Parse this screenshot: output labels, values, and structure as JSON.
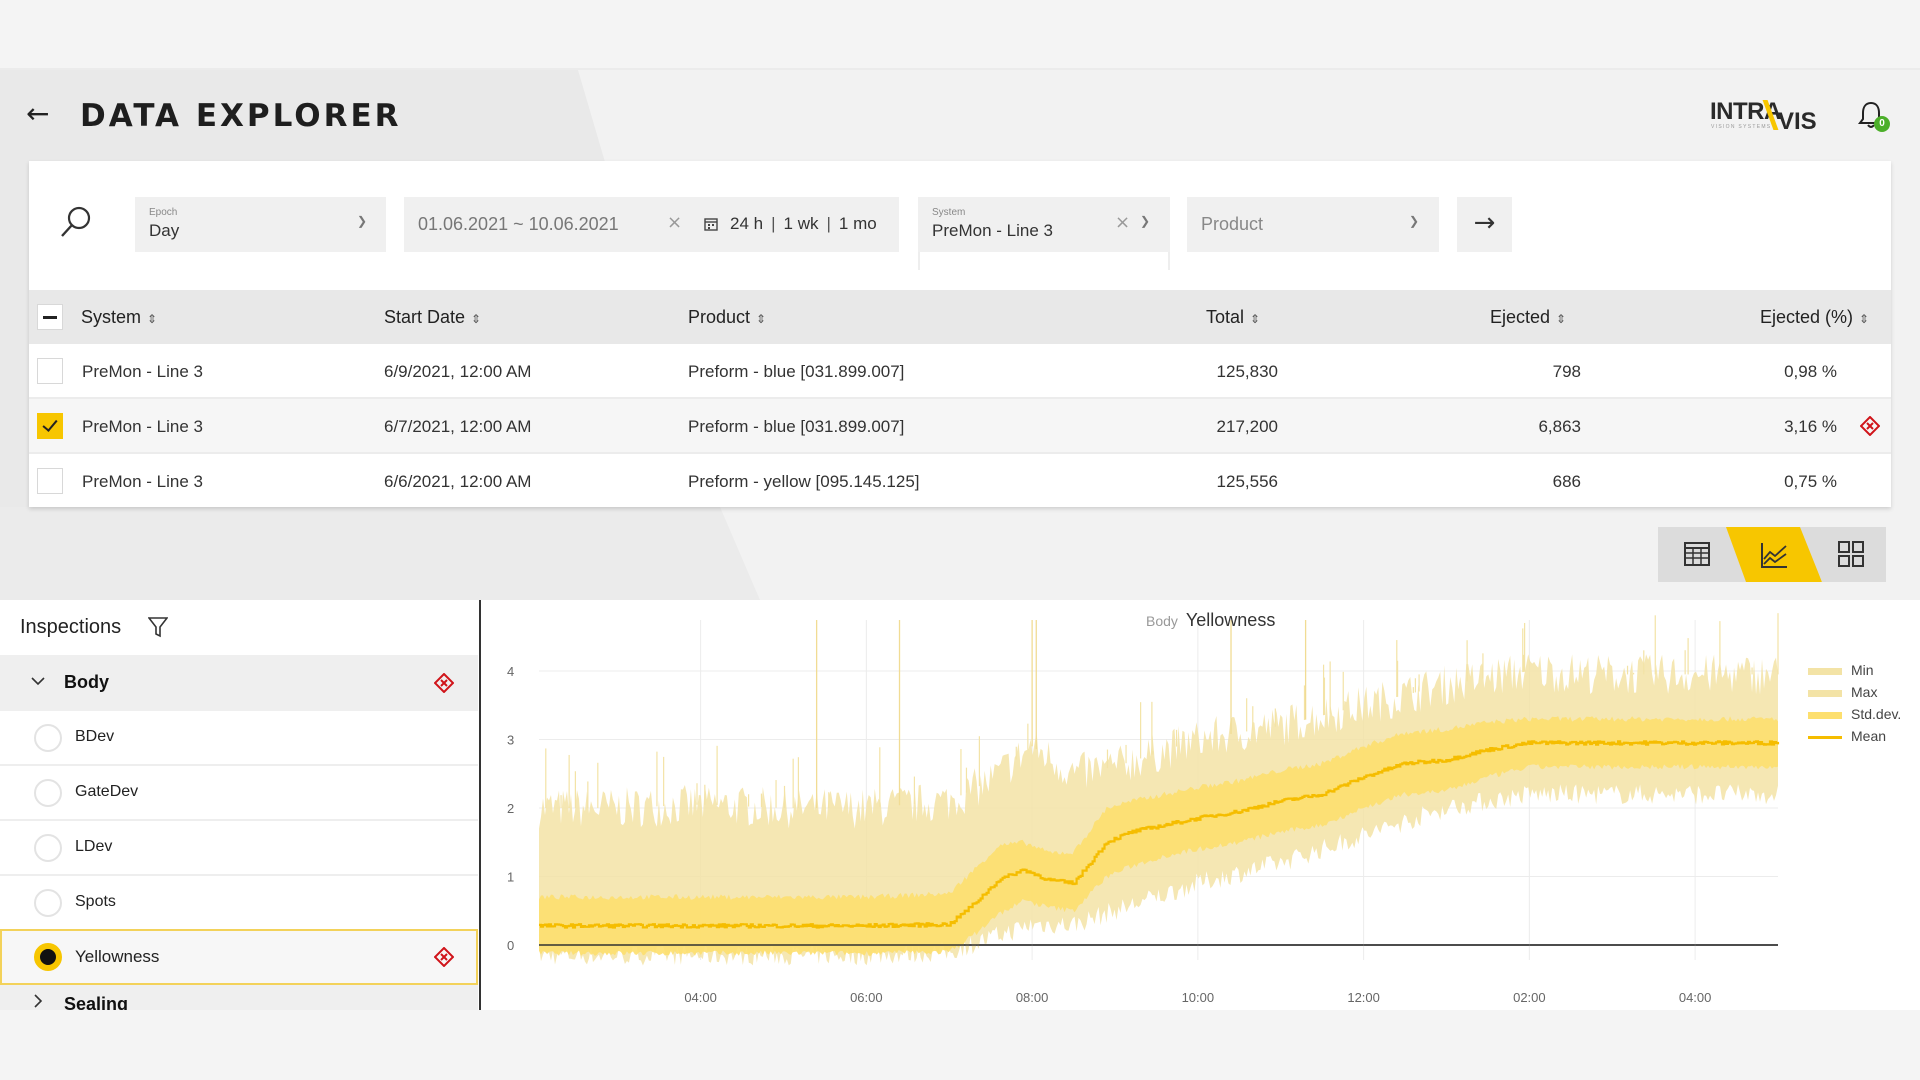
{
  "header": {
    "title": "DATA EXPLORER",
    "logo_main": "INTRA",
    "logo_vis": "VIS",
    "logo_sub": "VISION SYSTEMS",
    "notification_count": "0"
  },
  "filters": {
    "epoch": {
      "label": "Epoch",
      "value": "Day"
    },
    "date_range": {
      "value": "01.06.2021 ~ 10.06.2021",
      "quick": [
        "24 h",
        "1 wk",
        "1 mo"
      ]
    },
    "system": {
      "label": "System",
      "value": "PreMon - Line 3"
    },
    "product": {
      "placeholder": "Product"
    }
  },
  "table": {
    "columns": [
      "System",
      "Start Date",
      "Product",
      "Total",
      "Ejected",
      "Ejected (%)"
    ],
    "rows": [
      {
        "system": "PreMon - Line 3",
        "start": "6/9/2021, 12:00 AM",
        "product": "Preform - blue [031.899.007]",
        "total": "125,830",
        "ejected": "798",
        "pct": "0,98 %",
        "checked": false,
        "warning": false
      },
      {
        "system": "PreMon - Line 3",
        "start": "6/7/2021, 12:00 AM",
        "product": "Preform - blue [031.899.007]",
        "total": "217,200",
        "ejected": "6,863",
        "pct": "3,16 %",
        "checked": true,
        "warning": true
      },
      {
        "system": "PreMon - Line 3",
        "start": "6/6/2021, 12:00 AM",
        "product": "Preform - yellow [095.145.125]",
        "total": "125,556",
        "ejected": "686",
        "pct": "0,75 %",
        "checked": false,
        "warning": false
      }
    ]
  },
  "view_toggle": {
    "options": [
      "table-view",
      "chart-view",
      "grid-view"
    ],
    "active": "chart-view"
  },
  "inspections": {
    "title": "Inspections",
    "groups": [
      {
        "label": "Body",
        "expanded": true,
        "warning": true,
        "items": [
          {
            "label": "BDev",
            "selected": false
          },
          {
            "label": "GateDev",
            "selected": false
          },
          {
            "label": "LDev",
            "selected": false
          },
          {
            "label": "Spots",
            "selected": false
          },
          {
            "label": "Yellowness",
            "selected": true,
            "warning": true
          }
        ]
      },
      {
        "label": "Sealing",
        "expanded": false
      }
    ]
  },
  "colors": {
    "accent": "#f7c600",
    "warning": "#d0141a",
    "badge": "#4caf2a",
    "min_max": "#f3e3a6",
    "std": "#fddf6e",
    "mean": "#f5bd00"
  },
  "chart_data": {
    "type": "area",
    "title": "Yellowness",
    "subtitle": "Body",
    "xlabel": "",
    "ylabel": "",
    "ylim": [
      -0.3,
      4.4
    ],
    "yticks": [
      0,
      1,
      2,
      3,
      4
    ],
    "xticks": [
      "04:00",
      "06:00",
      "08:00",
      "10:00",
      "12:00",
      "02:00",
      "04:00"
    ],
    "x_hours": [
      2.05,
      17.0
    ],
    "xtick_hours": [
      4,
      6,
      8,
      10,
      12,
      14,
      16
    ],
    "grid": true,
    "legend": {
      "position": "right",
      "entries": [
        "Min",
        "Max",
        "Std.dev.",
        "Mean"
      ]
    },
    "series": [
      {
        "name": "Mean",
        "x": [
          2.05,
          3,
          4,
          5,
          6,
          7,
          7.3,
          7.6,
          7.9,
          8.2,
          8.5,
          8.9,
          9.2,
          9.6,
          10,
          10.5,
          11,
          11.5,
          12,
          12.5,
          13,
          13.5,
          14,
          15,
          16,
          17
        ],
        "values": [
          0.28,
          0.28,
          0.28,
          0.28,
          0.28,
          0.3,
          0.6,
          0.95,
          1.1,
          0.95,
          0.9,
          1.5,
          1.65,
          1.75,
          1.85,
          1.95,
          2.1,
          2.2,
          2.45,
          2.65,
          2.7,
          2.85,
          2.95,
          2.95,
          2.95,
          2.95
        ]
      },
      {
        "name": "Std.dev.",
        "x": [
          2.05,
          3,
          4,
          5,
          6,
          7,
          7.3,
          7.6,
          7.9,
          8.2,
          8.5,
          8.9,
          9.2,
          9.6,
          10,
          10.5,
          11,
          11.5,
          12,
          12.5,
          13,
          13.5,
          14,
          15,
          16,
          17
        ],
        "upper": [
          0.7,
          0.7,
          0.7,
          0.7,
          0.7,
          0.75,
          1.1,
          1.45,
          1.5,
          1.35,
          1.35,
          2.0,
          2.1,
          2.2,
          2.3,
          2.4,
          2.55,
          2.65,
          2.9,
          3.1,
          3.15,
          3.25,
          3.3,
          3.3,
          3.3,
          3.3
        ],
        "lower": [
          -0.12,
          -0.12,
          -0.12,
          -0.12,
          -0.12,
          -0.1,
          0.15,
          0.45,
          0.65,
          0.55,
          0.5,
          1.0,
          1.15,
          1.3,
          1.4,
          1.5,
          1.65,
          1.75,
          2.0,
          2.2,
          2.25,
          2.45,
          2.6,
          2.6,
          2.6,
          2.6
        ]
      },
      {
        "name": "Max",
        "x": [
          2.05,
          3,
          4,
          5,
          6,
          7,
          7.5,
          8,
          8.5,
          9,
          10,
          11,
          12,
          13,
          14,
          15,
          16,
          17
        ],
        "values": [
          2.0,
          2.0,
          2.05,
          2.0,
          2.0,
          2.1,
          2.4,
          2.9,
          2.5,
          2.6,
          3.0,
          3.2,
          3.5,
          3.8,
          4.0,
          3.95,
          3.95,
          3.95
        ]
      },
      {
        "name": "Min",
        "x": [
          2.05,
          3,
          4,
          5,
          6,
          7,
          7.5,
          8,
          8.5,
          9,
          10,
          11,
          12,
          13,
          14,
          15,
          16,
          17
        ],
        "values": [
          -0.15,
          -0.15,
          -0.15,
          -0.15,
          -0.15,
          -0.1,
          0.1,
          0.3,
          0.3,
          0.5,
          0.9,
          1.2,
          1.6,
          2.0,
          2.2,
          2.2,
          2.2,
          2.2
        ]
      }
    ]
  }
}
